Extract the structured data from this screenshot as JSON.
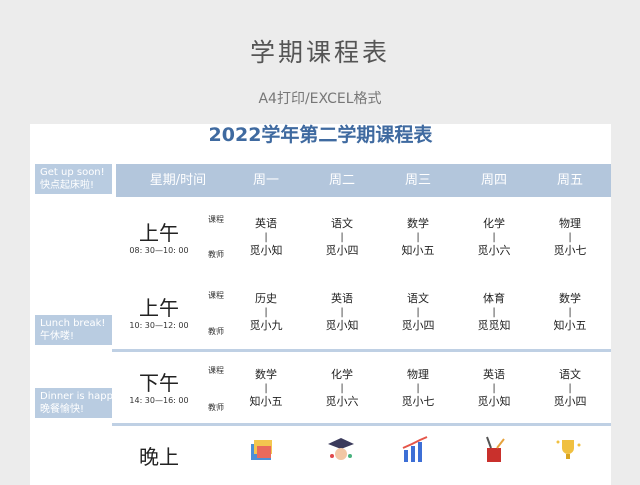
{
  "header": {
    "title": "学期课程表",
    "subtitle": "A4打印/EXCEL格式"
  },
  "sheet": {
    "title": "2022学年第二学期课程表",
    "columns": [
      "星期/时间",
      "周一",
      "周二",
      "周三",
      "周四",
      "周五"
    ],
    "row_labels": {
      "course": "课程",
      "teacher": "教师"
    },
    "bar": "|",
    "side_tags": [
      {
        "line1": "Get up soon!",
        "line2": "快点起床啦!"
      },
      {
        "line1": "Lunch break!",
        "line2": "午休喽!"
      },
      {
        "line1": "Dinner is happy!",
        "line2": "晚餐愉快!"
      }
    ],
    "periods": [
      {
        "name": "上午",
        "time": "08: 30—10: 00",
        "cells": [
          {
            "subject": "英语",
            "teacher": "觅小知"
          },
          {
            "subject": "语文",
            "teacher": "觅小四"
          },
          {
            "subject": "数学",
            "teacher": "知小五"
          },
          {
            "subject": "化学",
            "teacher": "觅小六"
          },
          {
            "subject": "物理",
            "teacher": "觅小七"
          }
        ]
      },
      {
        "name": "上午",
        "time": "10: 30—12: 00",
        "cells": [
          {
            "subject": "历史",
            "teacher": "觅小九"
          },
          {
            "subject": "英语",
            "teacher": "觅小知"
          },
          {
            "subject": "语文",
            "teacher": "觅小四"
          },
          {
            "subject": "体育",
            "teacher": "觅觅知"
          },
          {
            "subject": "数学",
            "teacher": "知小五"
          }
        ]
      },
      {
        "name": "下午",
        "time": "14: 30—16: 00",
        "cells": [
          {
            "subject": "数学",
            "teacher": "知小五"
          },
          {
            "subject": "化学",
            "teacher": "觅小六"
          },
          {
            "subject": "物理",
            "teacher": "觅小七"
          },
          {
            "subject": "英语",
            "teacher": "觅小知"
          },
          {
            "subject": "语文",
            "teacher": "觅小四"
          }
        ]
      },
      {
        "name": "晚上"
      }
    ],
    "evening_icons": [
      "books-icon",
      "graduate-icon",
      "bar-chart-icon",
      "pencil-cup-icon",
      "trophy-icon"
    ],
    "colors": {
      "accent": "#3f6aa0",
      "header_bar": "#b3c6dc",
      "tag": "#b9cce1"
    }
  }
}
